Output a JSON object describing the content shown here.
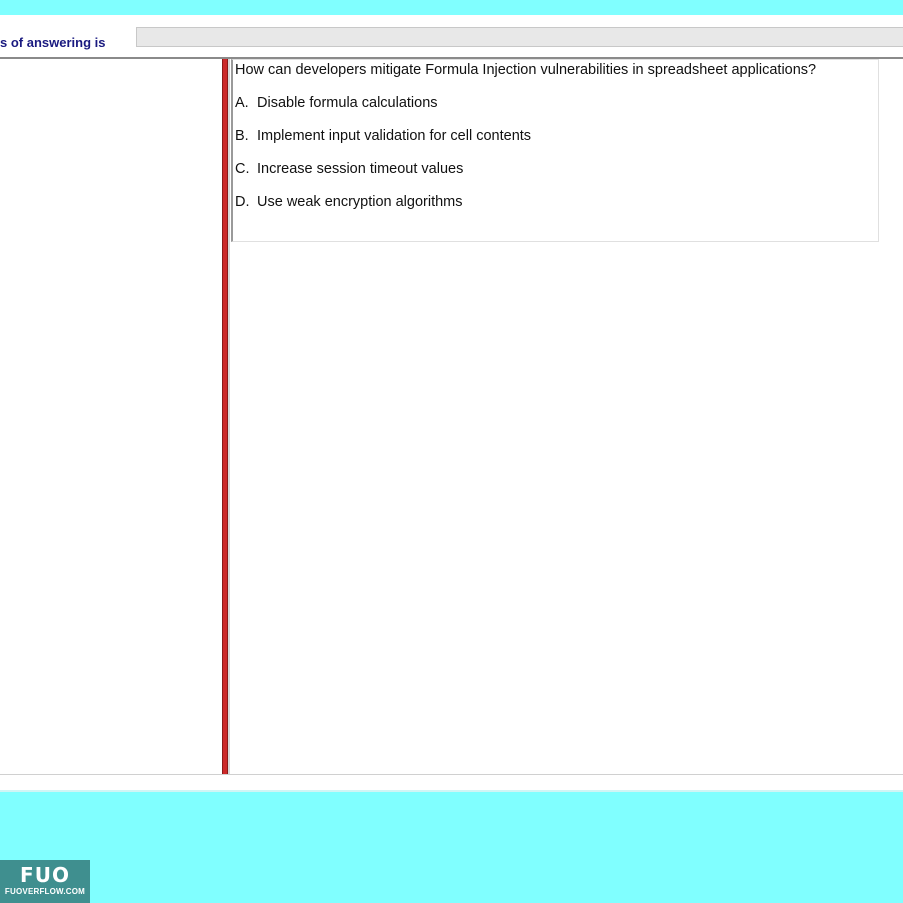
{
  "header": {
    "answering_label": "s of answering is",
    "answer_value": ""
  },
  "question": {
    "text": "How can developers mitigate Formula Injection vulnerabilities in spreadsheet applications?",
    "options": [
      {
        "letter": "A.",
        "text": "Disable formula calculations"
      },
      {
        "letter": "B.",
        "text": "Implement input validation for cell contents"
      },
      {
        "letter": "C.",
        "text": "Increase session timeout values"
      },
      {
        "letter": "D.",
        "text": "Use weak encryption algorithms"
      }
    ]
  },
  "watermark": {
    "mark": "FUO",
    "site": "FUOVERFLOW.COM"
  },
  "colors": {
    "band": "#80ffff",
    "splitter": "#cc2a2a",
    "label": "#1a1a80"
  }
}
